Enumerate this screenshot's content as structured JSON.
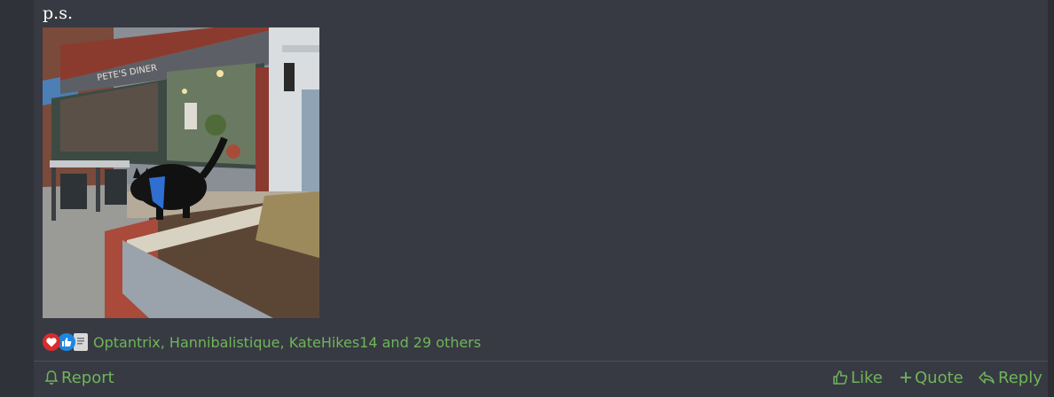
{
  "post": {
    "text": "p.s.",
    "image_alt": "Black cat wearing a blue bandana walking on a low brick wall outside a diner storefront",
    "storefront_sign": "PETE'S DINER"
  },
  "reactions": {
    "icons": [
      "heart-icon",
      "like-icon",
      "doc-icon"
    ],
    "summary": "Optantrix, Hannibalistique, KateHikes14 and 29 others"
  },
  "actions": {
    "report": "Report",
    "like": "Like",
    "quote": "Quote",
    "reply": "Reply"
  },
  "colors": {
    "background": "#2f3238",
    "post_background": "#373a42",
    "accent_green": "#6fb55a",
    "text": "#ffffff"
  }
}
